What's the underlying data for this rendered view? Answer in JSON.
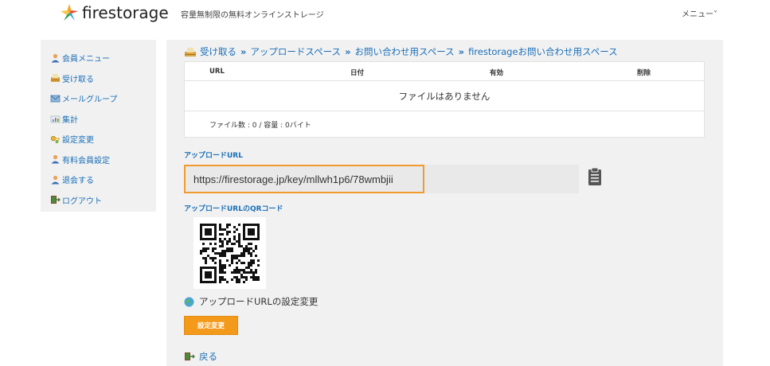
{
  "header": {
    "logo_text": "firestorage",
    "tagline": "容量無制限の無料オンラインストレージ",
    "menu_label": "メニュー˅"
  },
  "sidebar": {
    "items": [
      {
        "label": "会員メニュー",
        "icon": "user-icon"
      },
      {
        "label": "受け取る",
        "icon": "inbox-icon"
      },
      {
        "label": "メールグループ",
        "icon": "mail-group-icon"
      },
      {
        "label": "集計",
        "icon": "chart-icon"
      },
      {
        "label": "設定変更",
        "icon": "key-icon"
      },
      {
        "label": "有料会員設定",
        "icon": "user-icon"
      },
      {
        "label": "退会する",
        "icon": "user-icon"
      },
      {
        "label": "ログアウト",
        "icon": "logout-icon"
      }
    ]
  },
  "breadcrumb": {
    "items": [
      "受け取る",
      "アップロードスペース",
      "お問い合わせ用スペース",
      "firestorageお問い合わせ用スペース"
    ],
    "separator": "»"
  },
  "file_table": {
    "columns": [
      "URL",
      "日付",
      "有効",
      "削除"
    ],
    "empty_message": "ファイルはありません",
    "summary": "ファイル数 : 0 / 容量 : 0バイト"
  },
  "upload_url": {
    "label": "アップロードURL",
    "value": "https://firestorage.jp/key/mllwh1p6/78wmbjii"
  },
  "qr": {
    "label": "アップロードURLのQRコード"
  },
  "settings": {
    "link_label": "アップロードURLの設定変更",
    "button_label": "設定変更"
  },
  "back": {
    "label": "戻る"
  },
  "colors": {
    "link": "#1a6fb8",
    "accent_orange": "#f39a1b",
    "panel_bg": "#f1f1f1"
  }
}
